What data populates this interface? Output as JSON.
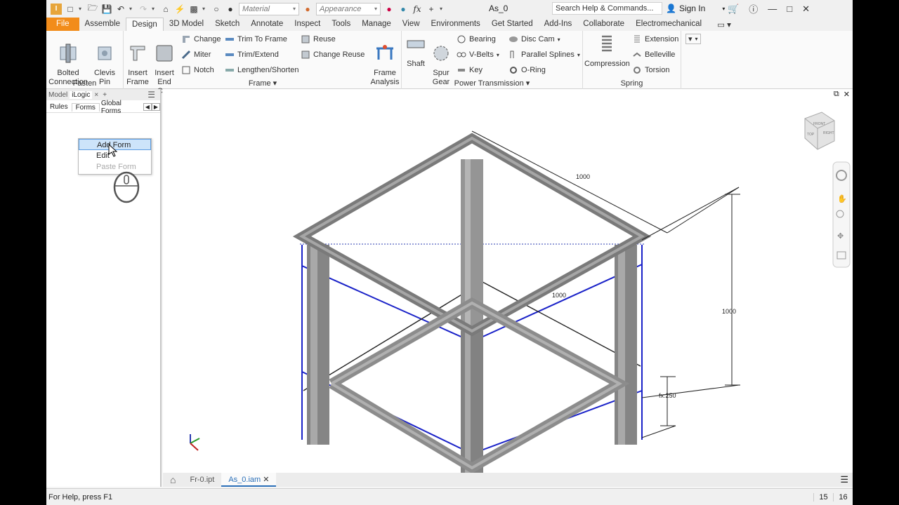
{
  "app": {
    "doc_title": "As_0"
  },
  "qat": {
    "material_placeholder": "Material",
    "appearance_placeholder": "Appearance",
    "fx_label": "fx"
  },
  "search": {
    "placeholder": "Search Help & Commands..."
  },
  "account": {
    "signin_label": "Sign In"
  },
  "menu_tabs": [
    "File",
    "Assemble",
    "Design",
    "3D Model",
    "Sketch",
    "Annotate",
    "Inspect",
    "Tools",
    "Manage",
    "View",
    "Environments",
    "Get Started",
    "Add-Ins",
    "Collaborate",
    "Electromechanical"
  ],
  "active_tab": "Design",
  "ribbon": {
    "fasten": {
      "title": "Fasten",
      "bolted": "Bolted\nConnection",
      "clevis": "Clevis\nPin"
    },
    "frame": {
      "title": "Frame",
      "insert_frame": "Insert\nFrame",
      "insert_end_cap": "Insert\nEnd Cap",
      "change": "Change",
      "miter": "Miter",
      "notch": "Notch",
      "trim_to_frame": "Trim To Frame",
      "trim_extend": "Trim/Extend",
      "lengthen_shorten": "Lengthen/Shorten",
      "reuse": "Reuse",
      "change_reuse": "Change Reuse",
      "frame_analysis": "Frame\nAnalysis"
    },
    "power": {
      "title": "Power Transmission",
      "shaft": "Shaft",
      "spur_gear": "Spur\nGear",
      "bearing": "Bearing",
      "vbelts": "V-Belts",
      "key": "Key",
      "disc_cam": "Disc Cam",
      "parallel_splines": "Parallel Splines",
      "oring": "O-Ring"
    },
    "spring": {
      "title": "Spring",
      "compression": "Compression",
      "extension": "Extension",
      "belleville": "Belleville",
      "torsion": "Torsion"
    }
  },
  "browser": {
    "tabs": [
      "Model",
      "iLogic"
    ],
    "close": "×",
    "add": "+",
    "subtabs": [
      "Rules",
      "Forms",
      "Global Forms"
    ],
    "active_subtab": "Forms",
    "context_menu": [
      "Add Form",
      "Edit",
      "Paste Form"
    ]
  },
  "viewport": {
    "dim_top": "1000",
    "dim_mid": "1000",
    "dim_right": "1000",
    "dim_fx": "fx:250",
    "viewcube_labels": [
      "FRONT",
      "RIGHT",
      "TOP"
    ]
  },
  "doc_tabs": [
    "Fr-0.ipt",
    "As_0.iam"
  ],
  "status": {
    "help_text": "For Help, press F1",
    "num1": "15",
    "num2": "16"
  },
  "colors": {
    "file_tab": "#f28c1a",
    "frame_gray": "#8a8a8a",
    "selection_blue": "#1a22c8"
  }
}
